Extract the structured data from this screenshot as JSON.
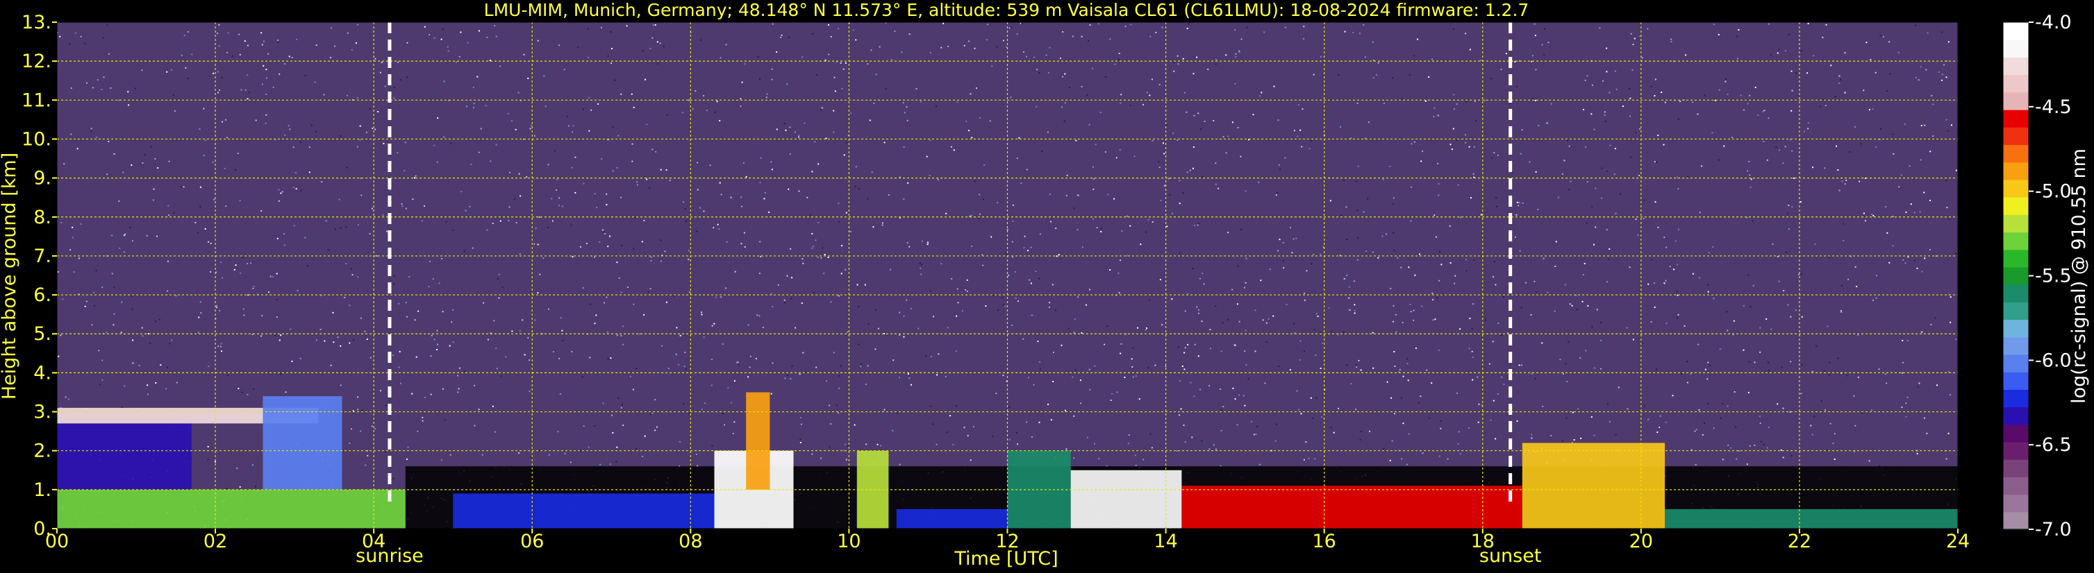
{
  "chart_data": {
    "type": "heatmap",
    "title": "LMU-MIM, Munich, Germany; 48.148° N 11.573° E, altitude: 539 m    Vaisala CL61 (CL61LMU): 18-08-2024    firmware: 1.2.7",
    "xlabel": "Time [UTC]",
    "ylabel": "Height above ground [km]",
    "xlim": [
      0,
      24
    ],
    "ylim": [
      0,
      13
    ],
    "x_ticks": [
      0,
      2,
      4,
      6,
      8,
      10,
      12,
      14,
      16,
      18,
      20,
      22,
      24
    ],
    "x_tick_labels": [
      "00",
      "02",
      "04",
      "06",
      "08",
      "10",
      "12",
      "14",
      "16",
      "18",
      "20",
      "22",
      "24"
    ],
    "y_ticks": [
      0,
      1,
      2,
      3,
      4,
      5,
      6,
      7,
      8,
      9,
      10,
      11,
      12,
      13
    ],
    "y_tick_labels": [
      "0.",
      "1.",
      "2.",
      "3.",
      "4.",
      "5.",
      "6.",
      "7.",
      "8.",
      "9.",
      "10.",
      "11.",
      "12.",
      "13."
    ],
    "grid": true,
    "colorbar": {
      "label": "log(rc-signal) @ 910.55 nm",
      "range": [
        -7.0,
        -4.0
      ],
      "ticks": [
        -7.0,
        -6.5,
        -6.0,
        -5.5,
        -5.0,
        -4.5,
        -4.0
      ],
      "tick_labels": [
        "-7.0",
        "-6.5",
        "-6.0",
        "-5.5",
        "-5.0",
        "-4.5",
        "-4.0"
      ],
      "colors": [
        "#a58ea5",
        "#9a779a",
        "#8c5e8c",
        "#7a427a",
        "#6a1f6e",
        "#5a0a6a",
        "#2a10b0",
        "#1a2be0",
        "#3a5cf0",
        "#5a80f0",
        "#6f9bea",
        "#6fb4dc",
        "#30a08c",
        "#1a8c6a",
        "#1a9a2a",
        "#2ab82a",
        "#6ed23a",
        "#b8e03a",
        "#f0f020",
        "#f8c818",
        "#f8a010",
        "#f87010",
        "#f03010",
        "#e80000",
        "#e6b4b4",
        "#ecc8c8",
        "#f0dcdc",
        "#f8f8f8",
        "#ffffff"
      ]
    },
    "annotations": [
      {
        "label": "sunrise",
        "x": 4.2
      },
      {
        "label": "sunset",
        "x": 18.35
      }
    ],
    "layers": [
      {
        "x0": 0.0,
        "x1": 4.4,
        "y0": 0.0,
        "y1": 1.0,
        "value": -5.3
      },
      {
        "x0": 0.0,
        "x1": 1.7,
        "y0": 1.0,
        "y1": 2.7,
        "value": -6.3
      },
      {
        "x0": 0.0,
        "x1": 3.3,
        "y0": 2.7,
        "y1": 3.1,
        "value": -4.3
      },
      {
        "x0": 2.6,
        "x1": 3.6,
        "y0": 1.0,
        "y1": 3.4,
        "value": -6.0
      },
      {
        "x0": 5.0,
        "x1": 8.3,
        "y0": 0.0,
        "y1": 0.9,
        "value": -6.2
      },
      {
        "x0": 8.3,
        "x1": 9.3,
        "y0": 0.0,
        "y1": 2.0,
        "value": -4.1
      },
      {
        "x0": 8.7,
        "x1": 9.0,
        "y0": 1.0,
        "y1": 3.5,
        "value": -4.9
      },
      {
        "x0": 10.1,
        "x1": 10.5,
        "y0": 0.0,
        "y1": 2.0,
        "value": -5.2
      },
      {
        "x0": 10.6,
        "x1": 12.0,
        "y0": 0.0,
        "y1": 0.5,
        "value": -6.2
      },
      {
        "x0": 12.0,
        "x1": 12.8,
        "y0": 0.0,
        "y1": 2.0,
        "value": -5.6
      },
      {
        "x0": 12.8,
        "x1": 14.2,
        "y0": 0.0,
        "y1": 1.5,
        "value": -4.2
      },
      {
        "x0": 14.2,
        "x1": 18.5,
        "y0": 0.0,
        "y1": 1.1,
        "value": -4.6
      },
      {
        "x0": 18.5,
        "x1": 20.3,
        "y0": 0.0,
        "y1": 2.2,
        "value": -5.0
      },
      {
        "x0": 20.3,
        "x1": 24.0,
        "y0": 0.0,
        "y1": 0.5,
        "value": -5.6
      }
    ]
  }
}
